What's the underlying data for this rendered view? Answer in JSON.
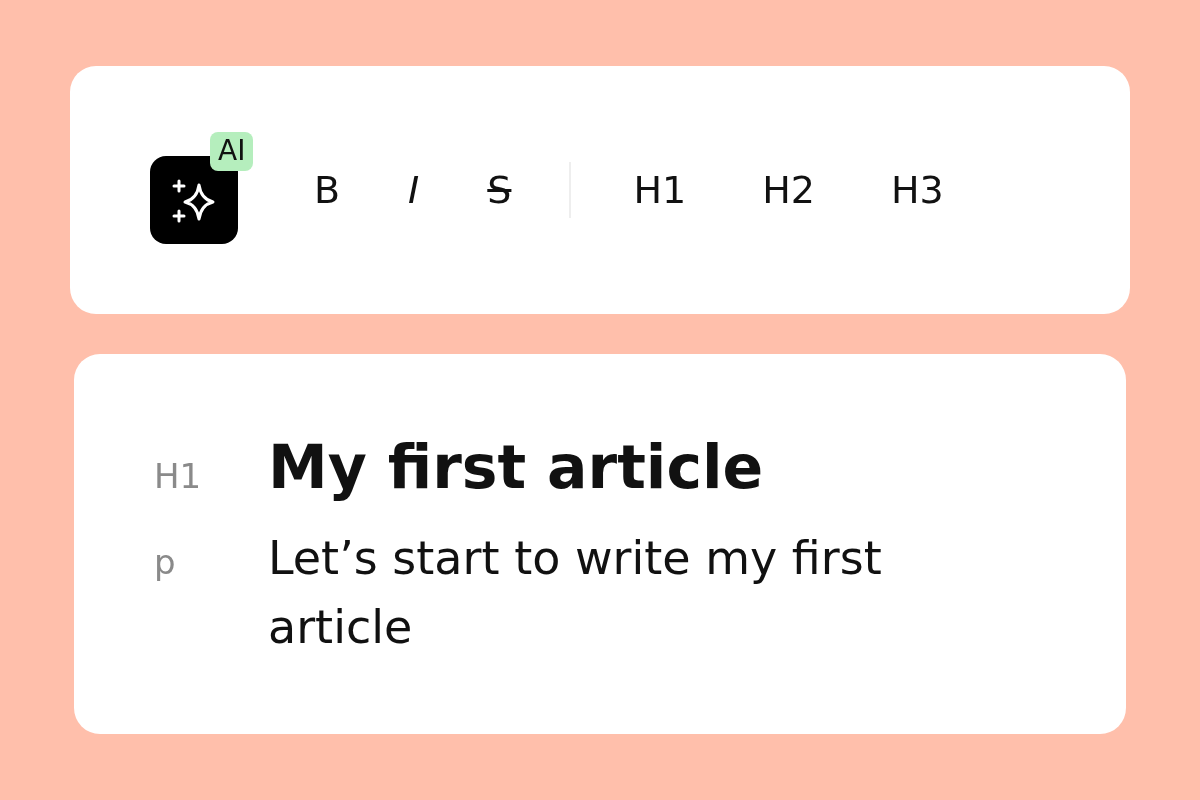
{
  "toolbar": {
    "ai_badge": "AI",
    "buttons": [
      {
        "label": "B",
        "kind": "bold"
      },
      {
        "label": "I",
        "kind": "italic"
      },
      {
        "label": "S",
        "kind": "strike"
      },
      {
        "label": "H1",
        "kind": "heading"
      },
      {
        "label": "H2",
        "kind": "heading"
      },
      {
        "label": "H3",
        "kind": "heading"
      }
    ]
  },
  "editor": {
    "blocks": [
      {
        "tag": "H1",
        "kind": "heading",
        "text": "My first article"
      },
      {
        "tag": "p",
        "kind": "paragraph",
        "text": "Let’s start to write my first article"
      }
    ]
  }
}
